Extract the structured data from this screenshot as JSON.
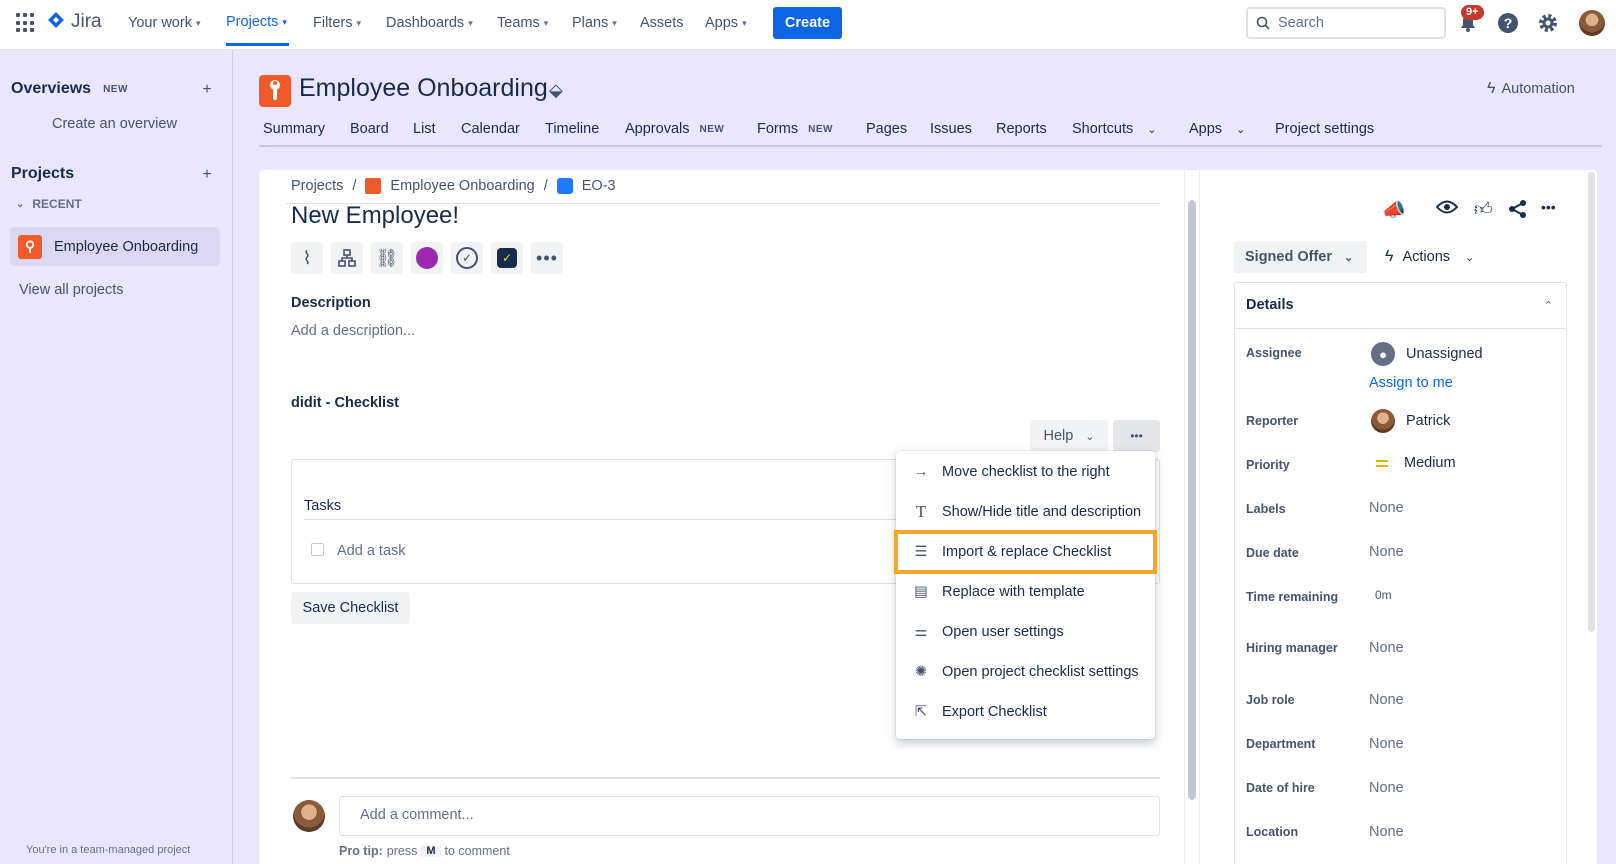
{
  "topnav": {
    "product": "Jira",
    "items": [
      {
        "label": "Your work",
        "chevron": true
      },
      {
        "label": "Projects",
        "chevron": true,
        "active": true
      },
      {
        "label": "Filters",
        "chevron": true
      },
      {
        "label": "Dashboards",
        "chevron": true
      },
      {
        "label": "Teams",
        "chevron": true
      },
      {
        "label": "Plans",
        "chevron": true
      },
      {
        "label": "Assets",
        "chevron": false
      },
      {
        "label": "Apps",
        "chevron": true
      }
    ],
    "create_label": "Create",
    "search_placeholder": "Search",
    "notif_badge": "9+"
  },
  "sidebar": {
    "overviews": "Overviews",
    "new_tag": "NEW",
    "create_overview": "Create an overview",
    "projects": "Projects",
    "recent": "RECENT",
    "recent_project": "Employee Onboarding",
    "view_all": "View all projects",
    "footer": "You're in a team-managed project"
  },
  "project": {
    "title": "Employee Onboarding",
    "automation": "Automation",
    "tabs": [
      {
        "label": "Summary"
      },
      {
        "label": "Board"
      },
      {
        "label": "List"
      },
      {
        "label": "Calendar"
      },
      {
        "label": "Timeline"
      },
      {
        "label": "Approvals",
        "tag": "NEW"
      },
      {
        "label": "Forms",
        "tag": "NEW"
      },
      {
        "label": "Pages"
      },
      {
        "label": "Issues"
      },
      {
        "label": "Reports"
      },
      {
        "label": "Shortcuts",
        "chevron": true
      },
      {
        "label": "Apps",
        "chevron": true
      },
      {
        "label": "Project settings"
      }
    ]
  },
  "issue": {
    "breadcrumb": {
      "root": "Projects",
      "project": "Employee Onboarding",
      "key": "EO-3"
    },
    "title": "New Employee!",
    "description_label": "Description",
    "description_placeholder": "Add a description...",
    "checklist_title": "didit - Checklist",
    "help_label": "Help",
    "tasks_label": "Tasks",
    "add_task_placeholder": "Add a task",
    "save_label": "Save Checklist",
    "comment_placeholder": "Add a comment...",
    "pro_tip": {
      "prefix": "Pro tip:",
      "press": "press",
      "key": "M",
      "suffix": "to comment"
    }
  },
  "menu": {
    "items": [
      {
        "label": "Move checklist to the right",
        "icon": "arrow-right-icon"
      },
      {
        "label": "Show/Hide title and description",
        "icon": "text-icon"
      },
      {
        "label": "Import & replace Checklist",
        "icon": "list-icon",
        "highlighted": true
      },
      {
        "label": "Replace with template",
        "icon": "template-icon"
      },
      {
        "label": "Open user settings",
        "icon": "sliders-icon"
      },
      {
        "label": "Open project checklist settings",
        "icon": "gear-icon"
      },
      {
        "label": "Export Checklist",
        "icon": "export-icon"
      }
    ]
  },
  "details": {
    "status": "Signed Offer",
    "actions": "Actions",
    "header": "Details",
    "assignee_label": "Assignee",
    "assignee": "Unassigned",
    "assign_to_me": "Assign to me",
    "reporter_label": "Reporter",
    "reporter": "Patrick",
    "priority_label": "Priority",
    "priority": "Medium",
    "fields": [
      {
        "label": "Labels",
        "value": "None"
      },
      {
        "label": "Due date",
        "value": "None"
      },
      {
        "label": "Time remaining",
        "value": "0m"
      },
      {
        "label": "Hiring manager",
        "value": "None"
      },
      {
        "label": "Job role",
        "value": "None"
      },
      {
        "label": "Department",
        "value": "None"
      },
      {
        "label": "Date of hire",
        "value": "None"
      },
      {
        "label": "Location",
        "value": "None"
      }
    ]
  },
  "colors": {
    "accent": "#0c66e4",
    "highlight": "#f6a62a",
    "badge": "#c9372c"
  }
}
